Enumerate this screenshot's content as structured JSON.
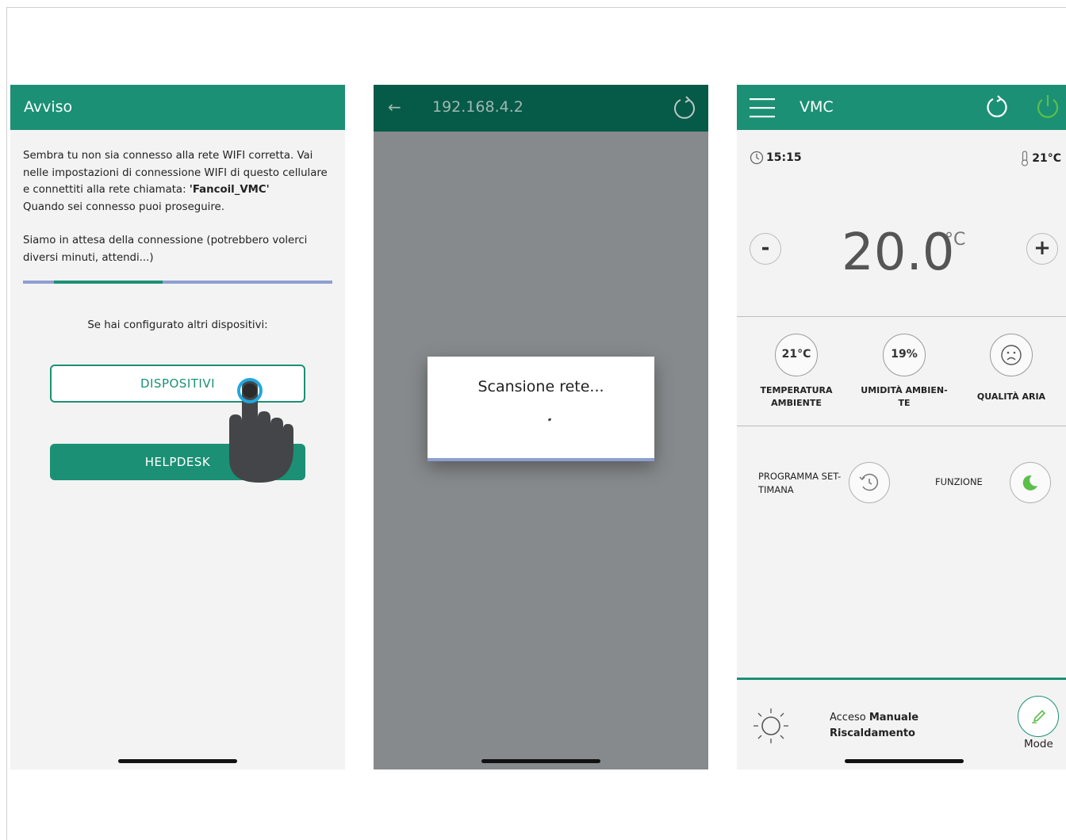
{
  "screen1": {
    "header_title": "Avviso",
    "message_part1": "Sembra tu non sia connesso alla rete WIFI corretta. Vai nelle impostazioni di connessione WIFI di questo cellulare e connettiti alla rete chiamata: ",
    "network_name": "'Fancoil_VMC'",
    "message_part2": "Quando sei connesso puoi proseguire.",
    "message_part3": "Siamo in attesa della connessione (potrebbero volerci diversi minuti, attendi...)",
    "progress": {
      "start_fraction": 0.1,
      "end_fraction": 0.45
    },
    "other_devices_text": "Se hai configurato altri dispositivi:",
    "devices_button": "DISPOSITIVI",
    "helpdesk_button": "HELPDESK"
  },
  "screen2": {
    "header_address": "192.168.4.2",
    "dialog_title": "Scansione rete..."
  },
  "screen3": {
    "header_title": "VMC",
    "time": "15:15",
    "outdoor_temp": "21°C",
    "setpoint": "20.0",
    "setpoint_unit": "°C",
    "minus_symbol": "-",
    "plus_symbol": "+",
    "stats": [
      {
        "value": "21°C",
        "label_line1": "TEMPERATURA",
        "label_line2": "AMBIENTE"
      },
      {
        "value": "19%",
        "label_line1": "UMIDITÀ AMBIEN-",
        "label_line2": "TE"
      },
      {
        "value": "",
        "label_line1": "QUALITÀ ARIA",
        "label_line2": ""
      }
    ],
    "program_label_line1": "PROGRAMMA SET-",
    "program_label_line2": "TIMANA",
    "function_label": "FUNZIONE",
    "mode_line1_prefix": "Acceso ",
    "mode_line1_bold": "Manuale",
    "mode_line2": "Riscaldamento",
    "mode_button_label": "Mode"
  },
  "colors": {
    "brand_green": "#1b9075",
    "dark_green": "#065a48",
    "progress_blue": "#8e9fd1",
    "power_green": "#5bbf4a"
  },
  "icons": [
    "menu-icon",
    "refresh-icon",
    "power-icon",
    "clock-icon",
    "thermometer-icon",
    "sad-face-icon",
    "schedule-icon",
    "moon-icon",
    "sun-icon",
    "pencil-icon",
    "back-arrow-icon",
    "hand-pointer-icon"
  ]
}
